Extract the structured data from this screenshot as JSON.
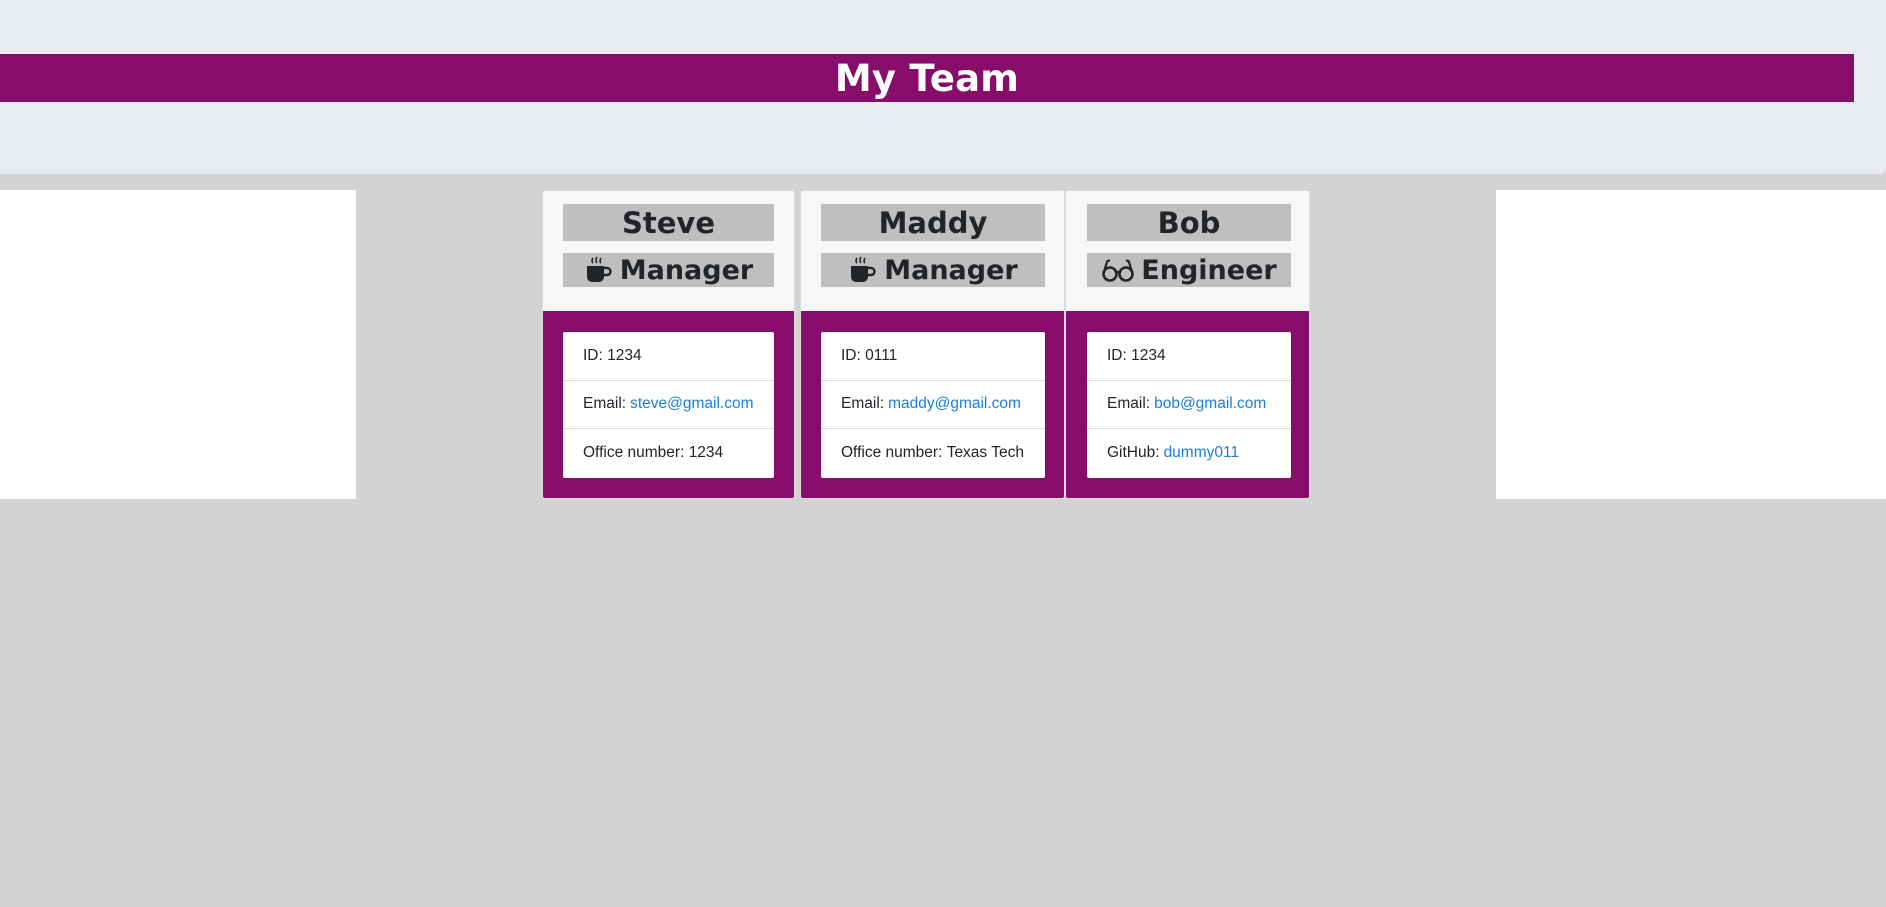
{
  "header": {
    "title": "My Team"
  },
  "team": [
    {
      "name": "Steve",
      "role": "Manager",
      "role_icon": "coffee-mug-icon",
      "details": [
        {
          "label": "ID:",
          "value": "1234",
          "is_link": false
        },
        {
          "label": "Email:",
          "value": "steve@gmail.com",
          "is_link": true
        },
        {
          "label": "Office number:",
          "value": "1234",
          "is_link": false
        }
      ]
    },
    {
      "name": "Maddy",
      "role": "Manager",
      "role_icon": "coffee-mug-icon",
      "details": [
        {
          "label": "ID:",
          "value": "0111",
          "is_link": false
        },
        {
          "label": "Email:",
          "value": "maddy@gmail.com",
          "is_link": true
        },
        {
          "label": "Office number:",
          "value": "Texas Tech",
          "is_link": false
        }
      ]
    },
    {
      "name": "Bob",
      "role": "Engineer",
      "role_icon": "glasses-icon",
      "details": [
        {
          "label": "ID:",
          "value": "1234",
          "is_link": false
        },
        {
          "label": "Email:",
          "value": "bob@gmail.com",
          "is_link": true
        },
        {
          "label": "GitHub:",
          "value": "dummy011",
          "is_link": true
        }
      ]
    }
  ],
  "colors": {
    "accent": "#880c69",
    "page_bg": "#d3d3d3",
    "header_bg": "#e9ecef",
    "label_box": "#bfbfbf",
    "link": "#1a7fe0"
  }
}
